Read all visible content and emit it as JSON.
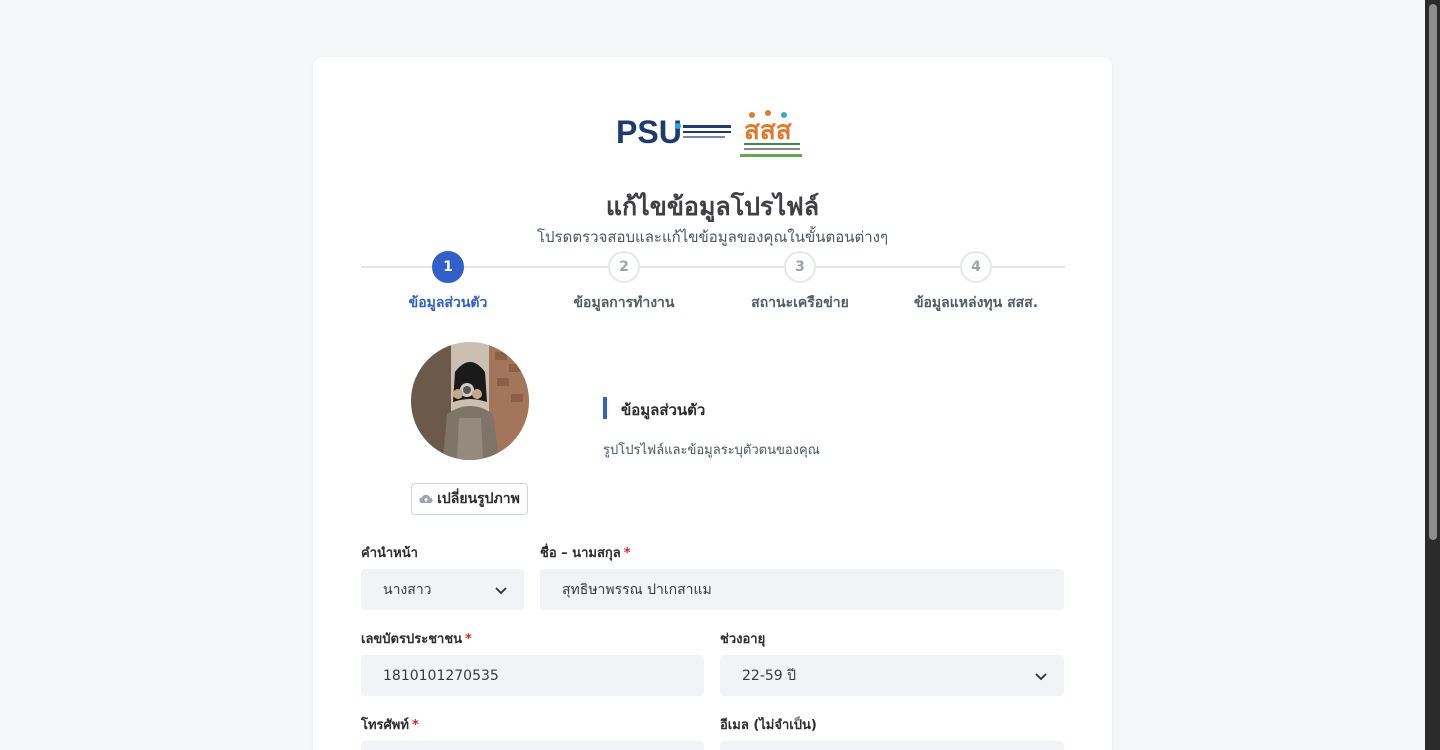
{
  "logos": {
    "primary": "PSU",
    "secondary": "สสส"
  },
  "header": {
    "title": "แก้ไขข้อมูลโปรไฟล์",
    "subtitle": "โปรดตรวจสอบและแก้ไขข้อมูลของคุณในขั้นตอนต่างๆ"
  },
  "steps": [
    {
      "number": "1",
      "label": "ข้อมูลส่วนตัว",
      "active": true
    },
    {
      "number": "2",
      "label": "ข้อมูลการทำงาน",
      "active": false
    },
    {
      "number": "3",
      "label": "สถานะเครือข่าย",
      "active": false
    },
    {
      "number": "4",
      "label": "ข้อมูลแหล่งทุน สสส.",
      "active": false
    }
  ],
  "profile": {
    "change_photo_label": "เปลี่ยนรูปภาพ",
    "section_title": "ข้อมูลส่วนตัว",
    "section_desc": "รูปโปรไฟล์และข้อมูลระบุตัวตนของคุณ"
  },
  "form": {
    "prefix": {
      "label": "คำนำหน้า",
      "value": "นางสาว"
    },
    "fullname": {
      "label": "ชื่อ – นามสกุล",
      "required": "*",
      "value": "สุทธิษาพรรณ ปาเกสาแม"
    },
    "national_id": {
      "label": "เลขบัตรประชาชน",
      "required": "*",
      "value": "1810101270535"
    },
    "age_range": {
      "label": "ช่วงอายุ",
      "value": "22-59 ปี"
    },
    "phone": {
      "label": "โทรศัพท์",
      "required": "*",
      "value": ""
    },
    "email": {
      "label": "อีเมล (ไม่จำเป็น)",
      "value": ""
    }
  },
  "colors": {
    "accent": "#3160c8",
    "required": "#dc2626",
    "field_bg": "#f1f3f6"
  }
}
